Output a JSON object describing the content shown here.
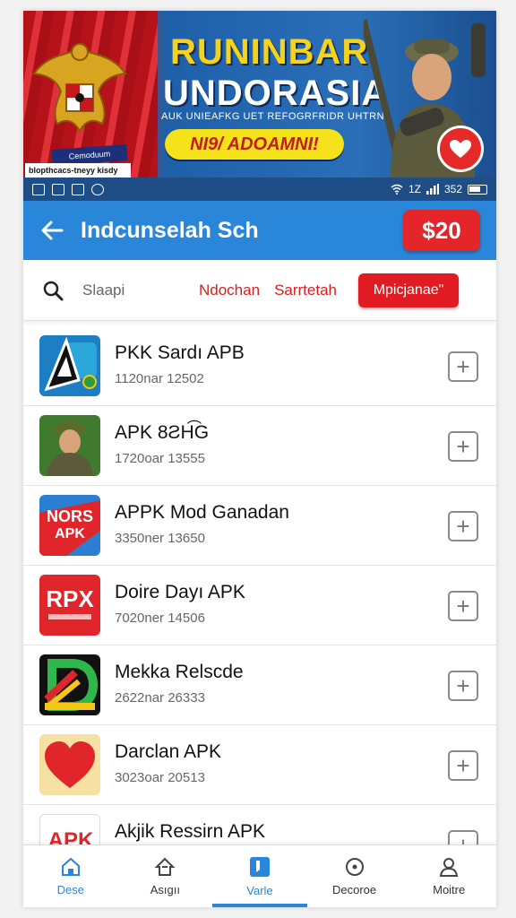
{
  "banner": {
    "title_line1": "RUNINBAR",
    "title_line2": "UNDORASIA",
    "tagline": "AUK UNIEAFKG UET REFOGRFRIDR UHTRN",
    "cta": "NI9/ ADOAMNI!",
    "tag": "Cemoduum",
    "subtag": "blopthcacs-tneyy kisdy"
  },
  "status": {
    "carrier": "1Z",
    "battery": "352"
  },
  "appbar": {
    "title": "Indcunselah Sch",
    "price": "$20"
  },
  "search": {
    "placeholder": "Slaapi",
    "filters": [
      "Ndochan",
      "Sarrtetah"
    ],
    "promo": "Mpicjanae\""
  },
  "apps": [
    {
      "title": "PKK Sardı APB",
      "sub": "1120nar 12502",
      "icon": "delta-logo-icon"
    },
    {
      "title": "APK 8ƧH͡G",
      "sub": "1720oar 13555",
      "icon": "soldier-portrait-icon"
    },
    {
      "title": "APPK Mod Ganadan",
      "sub": "3350ner 13650",
      "icon": "nors-apk-icon"
    },
    {
      "title": "Doire Dayı APK",
      "sub": "7020ner 14506",
      "icon": "rpx-logo-icon"
    },
    {
      "title": "Mekka Relscde",
      "sub": "2622nar 26333",
      "icon": "rainbow-d-icon"
    },
    {
      "title": "Darclan APK",
      "sub": "3023oar 20513",
      "icon": "heart-logo-icon"
    },
    {
      "title": "Akjik Ressirn APK",
      "sub": "",
      "icon": "apk-red-icon"
    }
  ],
  "nav": [
    {
      "label": "Dese",
      "icon": "home-icon",
      "active": false
    },
    {
      "label": "Asıgıı",
      "icon": "hat-icon",
      "active": false
    },
    {
      "label": "Varle",
      "icon": "bookmark-icon",
      "active": true
    },
    {
      "label": "Decoroe",
      "icon": "circle-icon",
      "active": false
    },
    {
      "label": "Moitre",
      "icon": "user-icon",
      "active": false
    }
  ],
  "colors": {
    "primary": "#2a86d9",
    "accent": "#e4262b"
  }
}
